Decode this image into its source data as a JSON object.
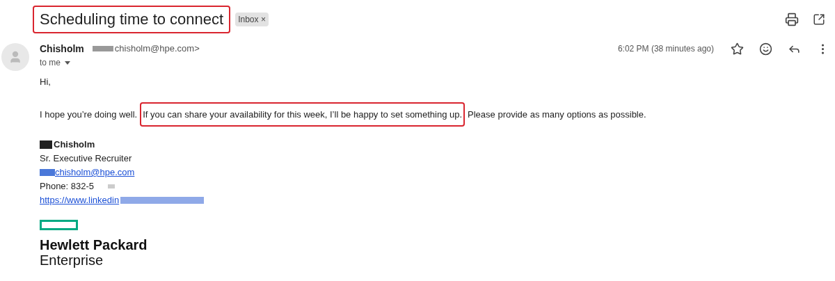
{
  "subject": "Scheduling time to connect",
  "label": {
    "text": "Inbox",
    "remove": "×"
  },
  "sender": {
    "name": "Chisholm",
    "email": "chisholm@hpe.com>",
    "recipients": "to me"
  },
  "time": "6:02 PM (38 minutes ago)",
  "starred": false,
  "body": {
    "greeting": "Hi,",
    "paragraph": [
      {
        "text": "I hope you’re doing well.",
        "highlighted": false
      },
      {
        "text": "If you can share your availability for this week, I’ll be happy to set something up.",
        "highlighted": true
      },
      {
        "text": "Please provide as many options as possible.",
        "highlighted": false
      }
    ]
  },
  "signature": {
    "name": "Chisholm",
    "title": "Sr. Executive Recruiter",
    "email": "chisholm@hpe.com",
    "phone": "Phone: 832-5",
    "link": "https://www.linkedin"
  },
  "logo": {
    "line_1": "Hewlett Packard",
    "line_2": "Enterprise"
  }
}
